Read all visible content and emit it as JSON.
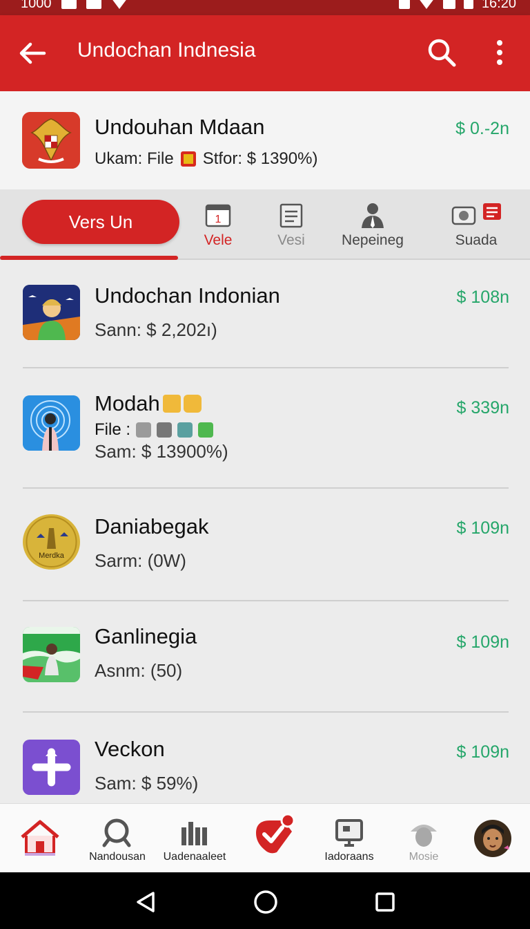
{
  "status_bar": {
    "left_text": "1000",
    "time": "16:20"
  },
  "app_bar": {
    "title": "Undochan Indnesia"
  },
  "header": {
    "title": "Undouhan Mdaan",
    "sub_left": "Ukam: File",
    "sub_right": "Stfor: $ 1390%)",
    "price": "$ 0.-2n"
  },
  "tabs": [
    {
      "label": "Vers Un",
      "icon": "pill"
    },
    {
      "label": "Vele",
      "icon": "calendar-icon"
    },
    {
      "label": "Vesi",
      "icon": "clipboard-icon"
    },
    {
      "label": "Nepeineg",
      "icon": "person-icon"
    },
    {
      "label": "Suada",
      "icon": "chat-icon"
    }
  ],
  "items": [
    {
      "name": "Undochan Indonian",
      "sub": "Sann: $ 2,202ı)",
      "price": "$ 108n",
      "thumb": "person-blue"
    },
    {
      "name": "Modah",
      "file_label": "File  :",
      "sub": "Sam: $ 13900%)",
      "price": "$ 339n",
      "thumb": "signal-blue"
    },
    {
      "name": "Daniabegak",
      "sub": "Sarm: (0W)",
      "price": "$ 109n",
      "thumb": "gold-coin",
      "thumb_text": "Merdka"
    },
    {
      "name": "Ganlinegia",
      "sub": "Asnm: (50)",
      "price": "$ 109n",
      "thumb": "green-hills"
    },
    {
      "name": "Veckon",
      "sub": "Sam: $ 59%)",
      "price": "$ 109n",
      "thumb": "purple-plus"
    }
  ],
  "bottom_nav": [
    {
      "label": "",
      "icon": "home-icon"
    },
    {
      "label": "Nandousan",
      "icon": "search-icon"
    },
    {
      "label": "Uadenaaleet",
      "icon": "bars-icon"
    },
    {
      "label": "",
      "icon": "tag-check-icon"
    },
    {
      "label": "Iadoraans",
      "icon": "monitor-icon"
    },
    {
      "label": "Mosie",
      "icon": "hat-icon"
    },
    {
      "label": "",
      "icon": "avatar"
    }
  ],
  "colors": {
    "primary": "#d32424",
    "price": "#25a66a",
    "background": "#ececec"
  }
}
